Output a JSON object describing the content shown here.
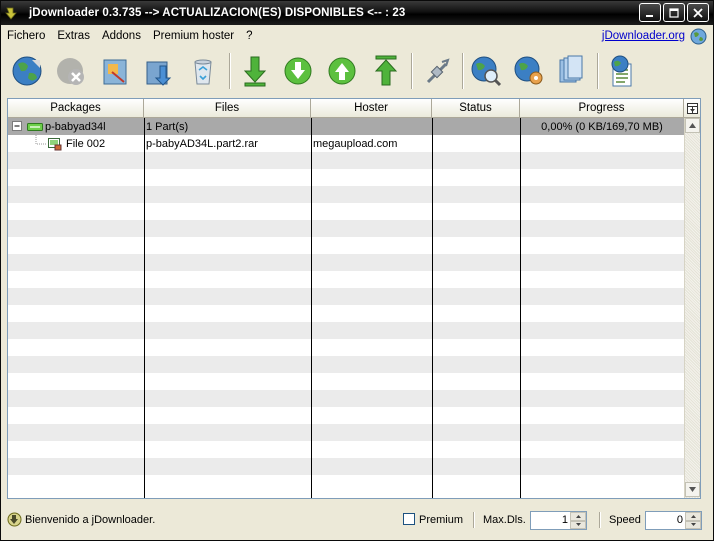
{
  "window": {
    "title": "jDownloader 0.3.735 --> ACTUALIZACION(ES) DISPONIBLES <-- : 23"
  },
  "menu": {
    "items": [
      "Fichero",
      "Extras",
      "Addons",
      "Premium hoster",
      "?"
    ],
    "site_link": "jDownloader.org"
  },
  "toolbar": {
    "buttons": [
      "add-links-icon",
      "remove-icon",
      "packager-icon",
      "download-icon",
      "recycle-bin-icon",
      "start-download-icon",
      "resume-icon",
      "move-up-icon",
      "move-top-icon",
      "reconnect-icon",
      "search-icon",
      "config-icon",
      "clipboard-icon",
      "update-icon"
    ]
  },
  "table": {
    "columns": [
      "Packages",
      "Files",
      "Hoster",
      "Status",
      "Progress"
    ],
    "rows": [
      {
        "package": "p-babyad34l",
        "files": "1 Part(s)",
        "hoster": "",
        "status": "",
        "progress": "0,00% (0 KB/169,70 MB)"
      },
      {
        "package": "File 002",
        "files": "p-babyAD34L.part2.rar",
        "hoster": "megaupload.com",
        "status": "",
        "progress": ""
      }
    ]
  },
  "statusbar": {
    "message": "Bienvenido a  jDownloader.",
    "premium_label": "Premium",
    "premium_checked": false,
    "maxdls_label": "Max.Dls.",
    "maxdls_value": "1",
    "speed_label": "Speed",
    "speed_value": "0"
  },
  "colors": {
    "selected_row": "#a9a9a9",
    "alt_row": "#ebebeb",
    "link": "#0000cc",
    "titlebar": "#000000"
  }
}
